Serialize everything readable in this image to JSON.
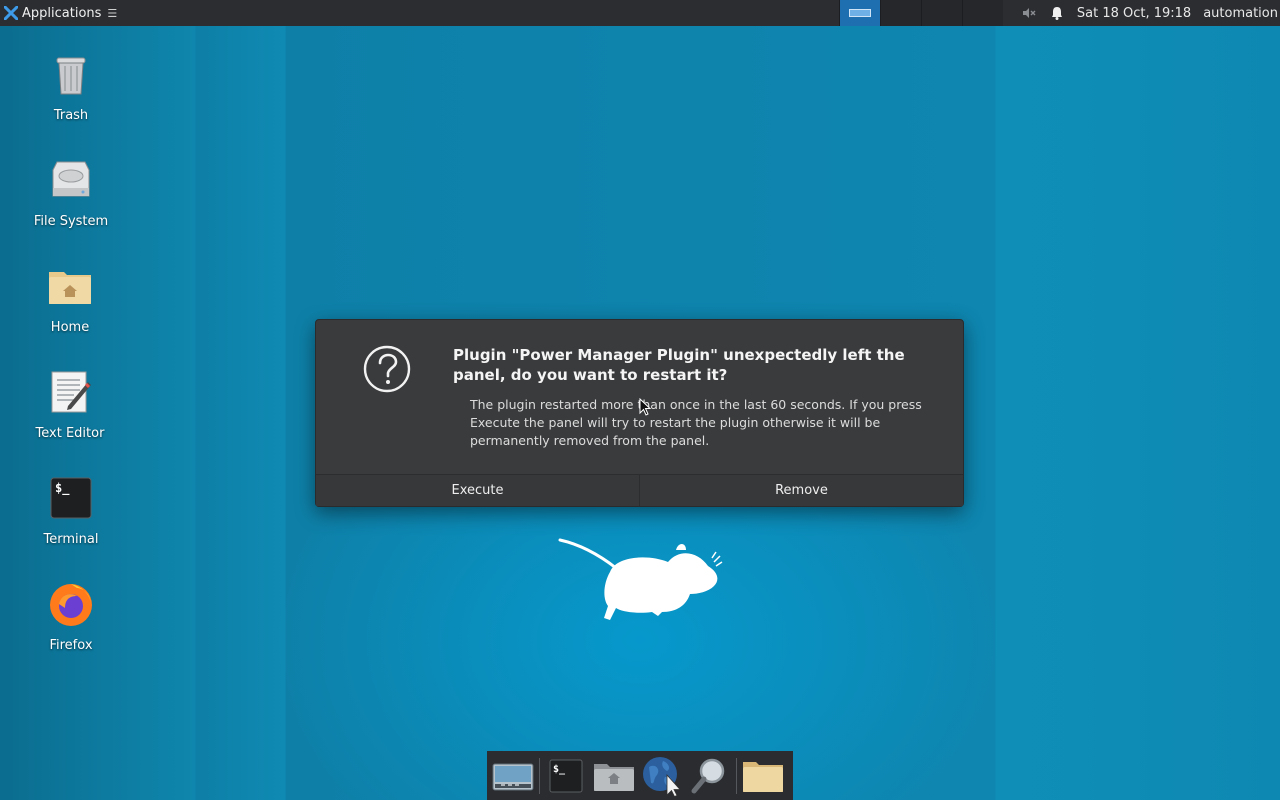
{
  "top_panel": {
    "applications_label": "Applications",
    "menu_glyph": "☰",
    "clock": "Sat 18 Oct, 19:18",
    "user": "automation",
    "tray_icons": [
      "volume-muted-icon",
      "notification-bell-icon"
    ],
    "workspaces": [
      {
        "active": true
      },
      {
        "active": false
      },
      {
        "active": false
      },
      {
        "active": false
      }
    ]
  },
  "desktop": {
    "icons": [
      {
        "name": "trash",
        "label": "Trash",
        "icon": "trash-icon"
      },
      {
        "name": "file-system",
        "label": "File System",
        "icon": "drive-icon"
      },
      {
        "name": "home",
        "label": "Home",
        "icon": "home-folder-icon"
      },
      {
        "name": "text-editor",
        "label": "Text Editor",
        "icon": "text-editor-icon"
      },
      {
        "name": "terminal",
        "label": "Terminal",
        "icon": "terminal-icon"
      },
      {
        "name": "firefox",
        "label": "Firefox",
        "icon": "firefox-icon"
      }
    ]
  },
  "dialog": {
    "icon": "question-icon",
    "title": "Plugin \"Power Manager Plugin\" unexpectedly left the panel, do you want to restart it?",
    "message": "The plugin restarted more than once in the last 60 seconds. If you press Execute the panel will try to restart the plugin otherwise it will be permanently removed from the panel.",
    "execute_label": "Execute",
    "remove_label": "Remove"
  },
  "dock": {
    "items": [
      "show-desktop-icon",
      "terminal-icon",
      "home-folder-icon",
      "web-browser-icon",
      "search-icon",
      "folder-icon"
    ]
  },
  "colors": {
    "panel": "#2b2d31",
    "dialog": "#3a3b3d",
    "desktop": "#0e86b0",
    "active_workspace": "#1e6fb0"
  }
}
